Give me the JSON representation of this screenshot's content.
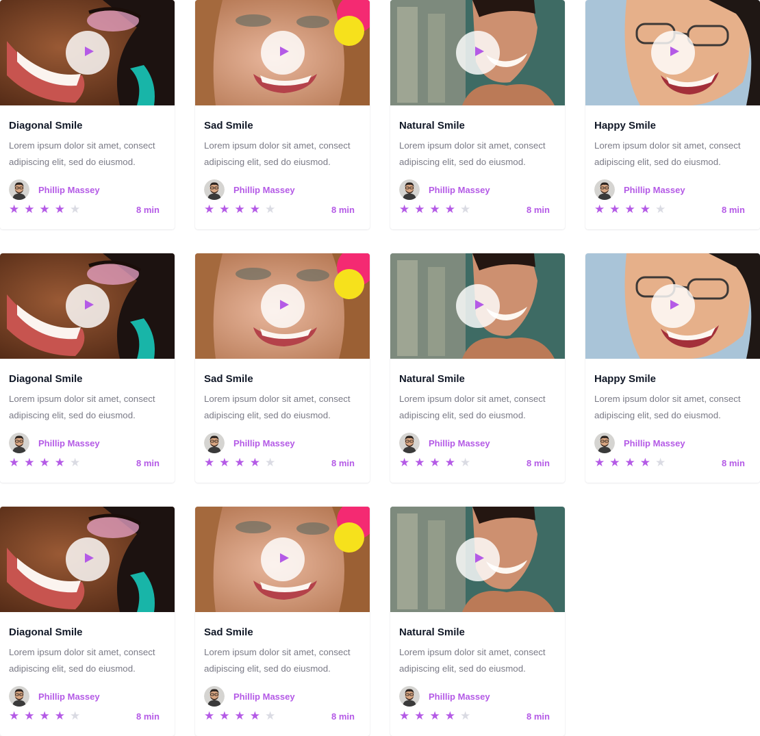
{
  "colors": {
    "accent": "#b45ae6",
    "title": "#111827",
    "text": "#7a7a86",
    "star_empty": "#dadbe3"
  },
  "icons": {
    "play": "play-icon",
    "star": "star-icon"
  },
  "cards": [
    {
      "title": "Diagonal Smile",
      "description": "Lorem ipsum dolor sit amet, consect adipiscing elit, sed do eiusmod.",
      "author": "Phillip Massey",
      "rating": 4,
      "rating_max": 5,
      "duration": "8 min",
      "thumb": "diagonal"
    },
    {
      "title": "Sad Smile",
      "description": "Lorem ipsum dolor sit amet, consect adipiscing elit, sed do eiusmod.",
      "author": "Phillip Massey",
      "rating": 4,
      "rating_max": 5,
      "duration": "8 min",
      "thumb": "sad"
    },
    {
      "title": "Natural Smile",
      "description": "Lorem ipsum dolor sit amet, consect adipiscing elit, sed do eiusmod.",
      "author": "Phillip Massey",
      "rating": 4,
      "rating_max": 5,
      "duration": "8 min",
      "thumb": "natural"
    },
    {
      "title": "Happy Smile",
      "description": "Lorem ipsum dolor sit amet, consect adipiscing elit, sed do eiusmod.",
      "author": "Phillip Massey",
      "rating": 4,
      "rating_max": 5,
      "duration": "8 min",
      "thumb": "happy"
    },
    {
      "title": "Diagonal Smile",
      "description": "Lorem ipsum dolor sit amet, consect adipiscing elit, sed do eiusmod.",
      "author": "Phillip Massey",
      "rating": 4,
      "rating_max": 5,
      "duration": "8 min",
      "thumb": "diagonal"
    },
    {
      "title": "Sad Smile",
      "description": "Lorem ipsum dolor sit amet, consect adipiscing elit, sed do eiusmod.",
      "author": "Phillip Massey",
      "rating": 4,
      "rating_max": 5,
      "duration": "8 min",
      "thumb": "sad"
    },
    {
      "title": "Natural Smile",
      "description": "Lorem ipsum dolor sit amet, consect adipiscing elit, sed do eiusmod.",
      "author": "Phillip Massey",
      "rating": 4,
      "rating_max": 5,
      "duration": "8 min",
      "thumb": "natural"
    },
    {
      "title": "Happy Smile",
      "description": "Lorem ipsum dolor sit amet, consect adipiscing elit, sed do eiusmod.",
      "author": "Phillip Massey",
      "rating": 4,
      "rating_max": 5,
      "duration": "8 min",
      "thumb": "happy"
    },
    {
      "title": "Diagonal Smile",
      "description": "Lorem ipsum dolor sit amet, consect adipiscing elit, sed do eiusmod.",
      "author": "Phillip Massey",
      "rating": 4,
      "rating_max": 5,
      "duration": "8 min",
      "thumb": "diagonal"
    },
    {
      "title": "Sad Smile",
      "description": "Lorem ipsum dolor sit amet, consect adipiscing elit, sed do eiusmod.",
      "author": "Phillip Massey",
      "rating": 4,
      "rating_max": 5,
      "duration": "8 min",
      "thumb": "sad"
    },
    {
      "title": "Natural Smile",
      "description": "Lorem ipsum dolor sit amet, consect adipiscing elit, sed do eiusmod.",
      "author": "Phillip Massey",
      "rating": 4,
      "rating_max": 5,
      "duration": "8 min",
      "thumb": "natural"
    }
  ]
}
